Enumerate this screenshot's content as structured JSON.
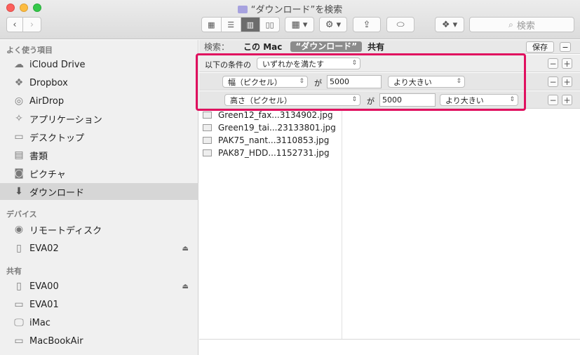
{
  "window": {
    "title": "“ダウンロード”を検索"
  },
  "toolbar": {
    "back_glyph": "‹",
    "forward_glyph": "›",
    "view_icons": [
      "icon-view-icon",
      "list-view-icon",
      "column-view-icon",
      "coverflow-view-icon"
    ],
    "search_placeholder": "検索"
  },
  "sidebar": {
    "favorites_header": "よく使う項目",
    "favorites": [
      {
        "label": "iCloud Drive",
        "icon": "cloud-icon"
      },
      {
        "label": "Dropbox",
        "icon": "dropbox-icon"
      },
      {
        "label": "AirDrop",
        "icon": "airdrop-icon"
      },
      {
        "label": "アプリケーション",
        "icon": "applications-icon"
      },
      {
        "label": "デスクトップ",
        "icon": "desktop-icon"
      },
      {
        "label": "書類",
        "icon": "documents-icon"
      },
      {
        "label": "ピクチャ",
        "icon": "camera-icon"
      },
      {
        "label": "ダウンロード",
        "icon": "download-icon"
      }
    ],
    "devices_header": "デバイス",
    "devices": [
      {
        "label": "リモートディスク",
        "icon": "disc-icon"
      },
      {
        "label": "EVA02",
        "icon": "drive-icon"
      }
    ],
    "shared_header": "共有",
    "shared": [
      {
        "label": "EVA00",
        "icon": "server-icon"
      },
      {
        "label": "EVA01",
        "icon": "server-icon"
      },
      {
        "label": "iMac",
        "icon": "imac-icon"
      },
      {
        "label": "MacBookAir",
        "icon": "laptop-icon"
      }
    ],
    "selected": "ダウンロード"
  },
  "search": {
    "label": "検索：",
    "scope_this_mac": "この Mac",
    "scope_folder": "“ダウンロード”",
    "scope_shared": "共有",
    "save_label": "保存",
    "criteria": {
      "prefix": "以下の条件の",
      "match_mode": "いずれかを満たす",
      "rules": [
        {
          "attribute": "幅（ピクセル）",
          "particle": "が",
          "value": "5000",
          "operator": "より大きい"
        },
        {
          "attribute": "高さ（ピクセル）",
          "particle": "が",
          "value": "5000",
          "operator": "より大きい"
        }
      ]
    }
  },
  "results": {
    "files": [
      "Green12_fax...3134902.jpg",
      "Green19_tai...23133801.jpg",
      "PAK75_nant...3110853.jpg",
      "PAK87_HDD...1152731.jpg"
    ]
  }
}
